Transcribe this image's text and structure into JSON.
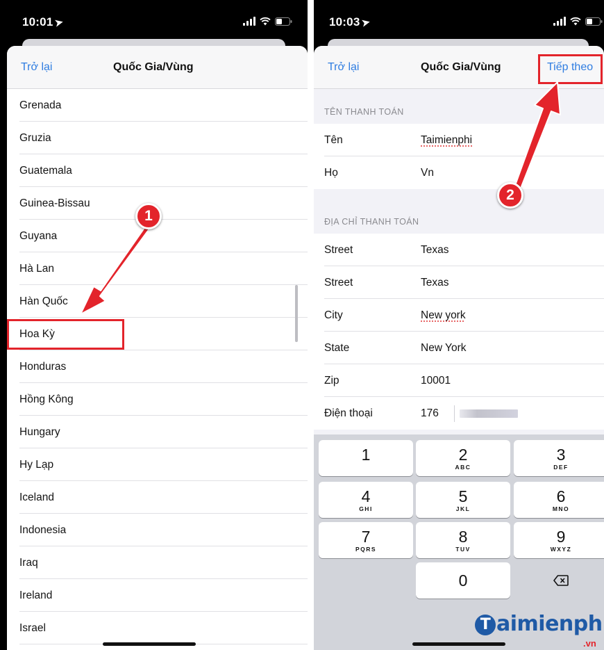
{
  "left_screen": {
    "status": {
      "time": "10:01"
    },
    "nav": {
      "back": "Trở lại",
      "title": "Quốc Gia/Vùng"
    },
    "countries": [
      "Grenada",
      "Gruzia",
      "Guatemala",
      "Guinea-Bissau",
      "Guyana",
      "Hà Lan",
      "Hàn Quốc",
      "Hoa Kỳ",
      "Honduras",
      "Hồng Kông",
      "Hungary",
      "Hy Lạp",
      "Iceland",
      "Indonesia",
      "Iraq",
      "Ireland",
      "Israel"
    ],
    "highlighted_country": "Hoa Kỳ"
  },
  "right_screen": {
    "status": {
      "time": "10:03"
    },
    "nav": {
      "back": "Trở lại",
      "title": "Quốc Gia/Vùng",
      "next": "Tiếp theo"
    },
    "billing_name": {
      "header": "TÊN THANH TOÁN",
      "first_name": {
        "label": "Tên",
        "value": "Taimienphi"
      },
      "last_name": {
        "label": "Họ",
        "value": "Vn"
      }
    },
    "billing_address": {
      "header": "ĐỊA CHỈ THANH TOÁN",
      "street1": {
        "label": "Street",
        "value": "Texas"
      },
      "street2": {
        "label": "Street",
        "value": "Texas"
      },
      "city": {
        "label": "City",
        "value": "New york"
      },
      "state": {
        "label": "State",
        "value": "New York"
      },
      "zip": {
        "label": "Zip",
        "value": "10001"
      },
      "phone": {
        "label": "Điện thoại",
        "value": "176"
      }
    },
    "keypad": {
      "k1": {
        "digit": "1",
        "letters": ""
      },
      "k2": {
        "digit": "2",
        "letters": "ABC"
      },
      "k3": {
        "digit": "3",
        "letters": "DEF"
      },
      "k4": {
        "digit": "4",
        "letters": "GHI"
      },
      "k5": {
        "digit": "5",
        "letters": "JKL"
      },
      "k6": {
        "digit": "6",
        "letters": "MNO"
      },
      "k7": {
        "digit": "7",
        "letters": "PQRS"
      },
      "k8": {
        "digit": "8",
        "letters": "TUV"
      },
      "k9": {
        "digit": "9",
        "letters": "WXYZ"
      },
      "k0": {
        "digit": "0",
        "letters": ""
      },
      "delete_icon": "backspace-icon"
    }
  },
  "annotations": {
    "step1": "1",
    "step2": "2",
    "annotation_color": "#e3242b"
  },
  "watermark": {
    "brand": "aimienphi",
    "brand_initial": "T",
    "suffix": ".vn"
  },
  "colors": {
    "ios_blue": "#2f7de1",
    "keyboard_bg": "#d2d4da",
    "grouped_bg": "#f2f2f7"
  }
}
